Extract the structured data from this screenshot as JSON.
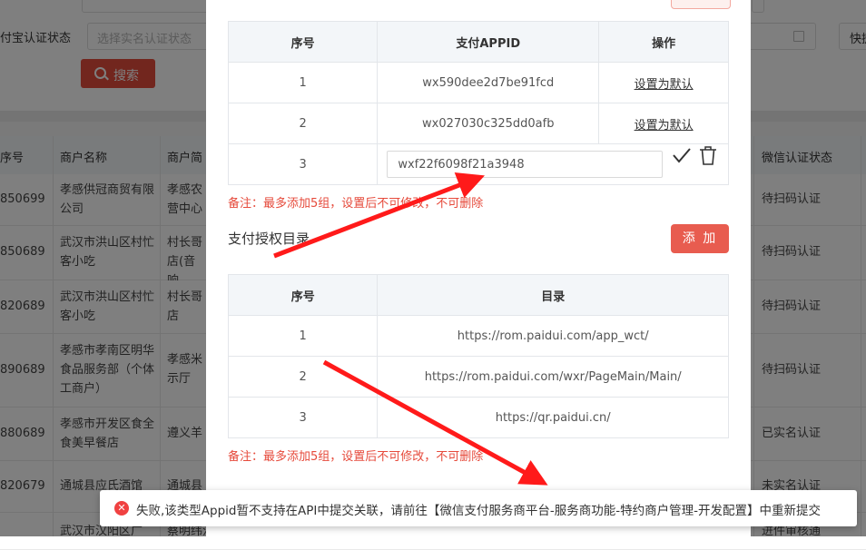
{
  "background_page": {
    "filter_label": "付宝认证状态",
    "filter_placeholder": "选择实名认证状态",
    "quick_button": "快捷",
    "search_button": "搜索",
    "table_headers": [
      "序号",
      "商户名称",
      "商户简",
      "微信认证状态"
    ],
    "rows": [
      {
        "id": "850699",
        "name": "孝感供冠商贸有限公司",
        "short": "孝感农营中心",
        "wx_status": "待扫码认证"
      },
      {
        "id": "850689",
        "name": "武汉市洪山区村忙客小吃",
        "short": "村长哥店(音响",
        "wx_status": "待扫码认证"
      },
      {
        "id": "820689",
        "name": "武汉市洪山区村忙客小吃",
        "short": "村长哥店",
        "wx_status": "待扫码认证"
      },
      {
        "id": "890689",
        "name": "孝感市孝南区明华食品服务部（个体工商户）",
        "short": "孝感米示厅",
        "wx_status": "待扫码认证"
      },
      {
        "id": "880689",
        "name": "孝感市开发区食全食美早餐店",
        "short": "遵义羊",
        "wx_status": "已实名认证"
      },
      {
        "id": "820679",
        "name": "通城县应氏酒馆",
        "short": "通城县",
        "wx_status": "未实名认证"
      },
      {
        "id": "",
        "name": "武汉市汉阳区广",
        "short": "蔡明纬江汉北路",
        "wx_status": "进件审核通"
      }
    ]
  },
  "modal": {
    "appid_table": {
      "headers": [
        "序号",
        "支付APPID",
        "操作"
      ],
      "rows": [
        {
          "no": "1",
          "appid": "wx590dee2d7be91fcd",
          "action": "设置为默认"
        },
        {
          "no": "2",
          "appid": "wx027030c325dd0afb",
          "action": "设置为默认"
        }
      ],
      "edit_row": {
        "no": "3",
        "value": "wxf22f6098f21a3948"
      }
    },
    "appid_note": "备注：最多添加5组，设置后不可修改，不可删除",
    "auth_dir_title": "支付授权目录",
    "add_button": "添 加",
    "dir_table": {
      "headers": [
        "序号",
        "目录"
      ],
      "rows": [
        {
          "no": "1",
          "dir": "https://rom.paidui.com/app_wct/"
        },
        {
          "no": "2",
          "dir": "https://rom.paidui.com/wxr/PageMain/Main/"
        },
        {
          "no": "3",
          "dir": "https://qr.paidui.cn/"
        }
      ]
    },
    "dir_note": "备注：最多添加5组，设置后不可修改，不可删除"
  },
  "toast": {
    "message": "失败,该类型Appid暂不支持在API中提交关联，请前往【微信支付服务商平台-服务商功能-特约商户管理-开发配置】中重新提交",
    "icon": "error-icon",
    "color": "#f04141"
  },
  "colors": {
    "accent_red": "#e85c4f",
    "note_red": "#e64a3b",
    "arrow_red": "#ff1a1a"
  }
}
